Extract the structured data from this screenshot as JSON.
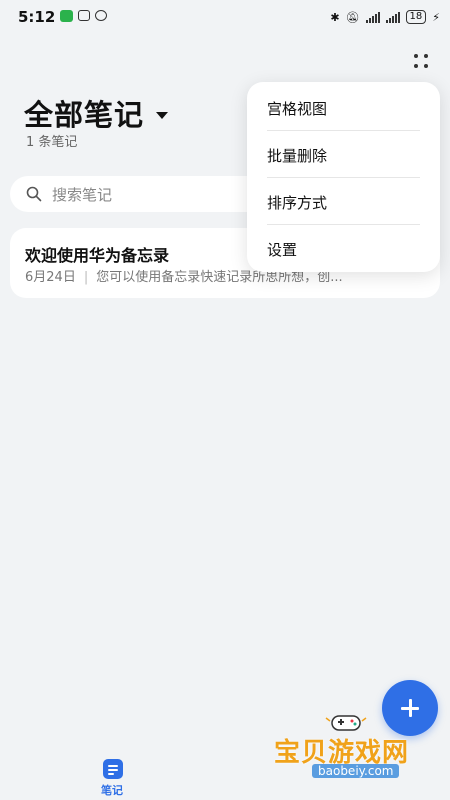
{
  "status_bar": {
    "time": "5:12",
    "battery": "18"
  },
  "header": {
    "title": "全部笔记",
    "count": "1 条笔记"
  },
  "search": {
    "placeholder": "搜索笔记"
  },
  "notes": [
    {
      "title": "欢迎使用华为备忘录",
      "date": "6月24日",
      "preview": "您可以使用备忘录快速记录所思所想，创..."
    }
  ],
  "menu": {
    "items": [
      "宫格视图",
      "批量删除",
      "排序方式",
      "设置"
    ]
  },
  "bottom_nav": {
    "notes_label": "笔记"
  },
  "watermark": {
    "text": "宝贝游戏网",
    "url": "baobeiy.com"
  },
  "colors": {
    "accent": "#2f6fe6",
    "background": "#f1f3f5",
    "watermark": "#f0a21a"
  }
}
